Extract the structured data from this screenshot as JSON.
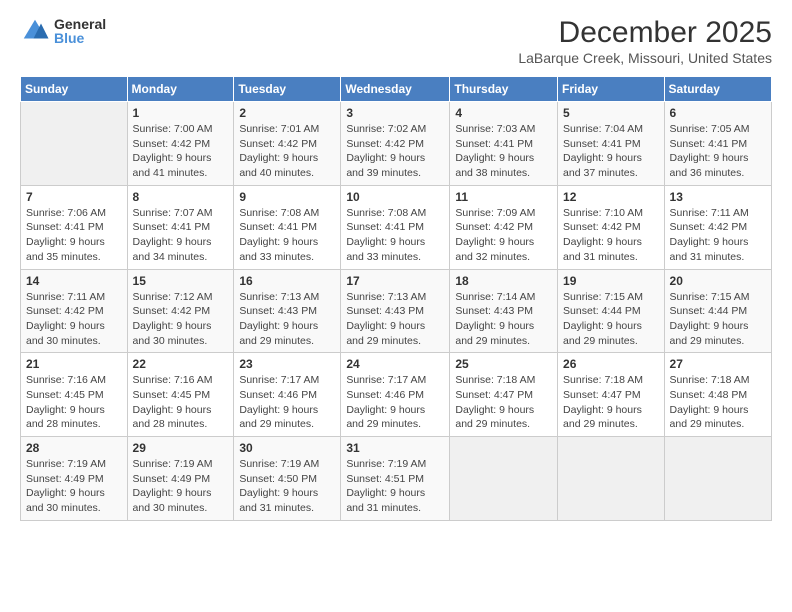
{
  "header": {
    "logo_general": "General",
    "logo_blue": "Blue",
    "main_title": "December 2025",
    "subtitle": "LaBarque Creek, Missouri, United States"
  },
  "calendar": {
    "days": [
      "Sunday",
      "Monday",
      "Tuesday",
      "Wednesday",
      "Thursday",
      "Friday",
      "Saturday"
    ]
  },
  "weeks": [
    [
      {
        "num": "",
        "info": ""
      },
      {
        "num": "1",
        "info": "Sunrise: 7:00 AM\nSunset: 4:42 PM\nDaylight: 9 hours\nand 41 minutes."
      },
      {
        "num": "2",
        "info": "Sunrise: 7:01 AM\nSunset: 4:42 PM\nDaylight: 9 hours\nand 40 minutes."
      },
      {
        "num": "3",
        "info": "Sunrise: 7:02 AM\nSunset: 4:42 PM\nDaylight: 9 hours\nand 39 minutes."
      },
      {
        "num": "4",
        "info": "Sunrise: 7:03 AM\nSunset: 4:41 PM\nDaylight: 9 hours\nand 38 minutes."
      },
      {
        "num": "5",
        "info": "Sunrise: 7:04 AM\nSunset: 4:41 PM\nDaylight: 9 hours\nand 37 minutes."
      },
      {
        "num": "6",
        "info": "Sunrise: 7:05 AM\nSunset: 4:41 PM\nDaylight: 9 hours\nand 36 minutes."
      }
    ],
    [
      {
        "num": "7",
        "info": "Sunrise: 7:06 AM\nSunset: 4:41 PM\nDaylight: 9 hours\nand 35 minutes."
      },
      {
        "num": "8",
        "info": "Sunrise: 7:07 AM\nSunset: 4:41 PM\nDaylight: 9 hours\nand 34 minutes."
      },
      {
        "num": "9",
        "info": "Sunrise: 7:08 AM\nSunset: 4:41 PM\nDaylight: 9 hours\nand 33 minutes."
      },
      {
        "num": "10",
        "info": "Sunrise: 7:08 AM\nSunset: 4:41 PM\nDaylight: 9 hours\nand 33 minutes."
      },
      {
        "num": "11",
        "info": "Sunrise: 7:09 AM\nSunset: 4:42 PM\nDaylight: 9 hours\nand 32 minutes."
      },
      {
        "num": "12",
        "info": "Sunrise: 7:10 AM\nSunset: 4:42 PM\nDaylight: 9 hours\nand 31 minutes."
      },
      {
        "num": "13",
        "info": "Sunrise: 7:11 AM\nSunset: 4:42 PM\nDaylight: 9 hours\nand 31 minutes."
      }
    ],
    [
      {
        "num": "14",
        "info": "Sunrise: 7:11 AM\nSunset: 4:42 PM\nDaylight: 9 hours\nand 30 minutes."
      },
      {
        "num": "15",
        "info": "Sunrise: 7:12 AM\nSunset: 4:42 PM\nDaylight: 9 hours\nand 30 minutes."
      },
      {
        "num": "16",
        "info": "Sunrise: 7:13 AM\nSunset: 4:43 PM\nDaylight: 9 hours\nand 29 minutes."
      },
      {
        "num": "17",
        "info": "Sunrise: 7:13 AM\nSunset: 4:43 PM\nDaylight: 9 hours\nand 29 minutes."
      },
      {
        "num": "18",
        "info": "Sunrise: 7:14 AM\nSunset: 4:43 PM\nDaylight: 9 hours\nand 29 minutes."
      },
      {
        "num": "19",
        "info": "Sunrise: 7:15 AM\nSunset: 4:44 PM\nDaylight: 9 hours\nand 29 minutes."
      },
      {
        "num": "20",
        "info": "Sunrise: 7:15 AM\nSunset: 4:44 PM\nDaylight: 9 hours\nand 29 minutes."
      }
    ],
    [
      {
        "num": "21",
        "info": "Sunrise: 7:16 AM\nSunset: 4:45 PM\nDaylight: 9 hours\nand 28 minutes."
      },
      {
        "num": "22",
        "info": "Sunrise: 7:16 AM\nSunset: 4:45 PM\nDaylight: 9 hours\nand 28 minutes."
      },
      {
        "num": "23",
        "info": "Sunrise: 7:17 AM\nSunset: 4:46 PM\nDaylight: 9 hours\nand 29 minutes."
      },
      {
        "num": "24",
        "info": "Sunrise: 7:17 AM\nSunset: 4:46 PM\nDaylight: 9 hours\nand 29 minutes."
      },
      {
        "num": "25",
        "info": "Sunrise: 7:18 AM\nSunset: 4:47 PM\nDaylight: 9 hours\nand 29 minutes."
      },
      {
        "num": "26",
        "info": "Sunrise: 7:18 AM\nSunset: 4:47 PM\nDaylight: 9 hours\nand 29 minutes."
      },
      {
        "num": "27",
        "info": "Sunrise: 7:18 AM\nSunset: 4:48 PM\nDaylight: 9 hours\nand 29 minutes."
      }
    ],
    [
      {
        "num": "28",
        "info": "Sunrise: 7:19 AM\nSunset: 4:49 PM\nDaylight: 9 hours\nand 30 minutes."
      },
      {
        "num": "29",
        "info": "Sunrise: 7:19 AM\nSunset: 4:49 PM\nDaylight: 9 hours\nand 30 minutes."
      },
      {
        "num": "30",
        "info": "Sunrise: 7:19 AM\nSunset: 4:50 PM\nDaylight: 9 hours\nand 31 minutes."
      },
      {
        "num": "31",
        "info": "Sunrise: 7:19 AM\nSunset: 4:51 PM\nDaylight: 9 hours\nand 31 minutes."
      },
      {
        "num": "",
        "info": ""
      },
      {
        "num": "",
        "info": ""
      },
      {
        "num": "",
        "info": ""
      }
    ]
  ]
}
